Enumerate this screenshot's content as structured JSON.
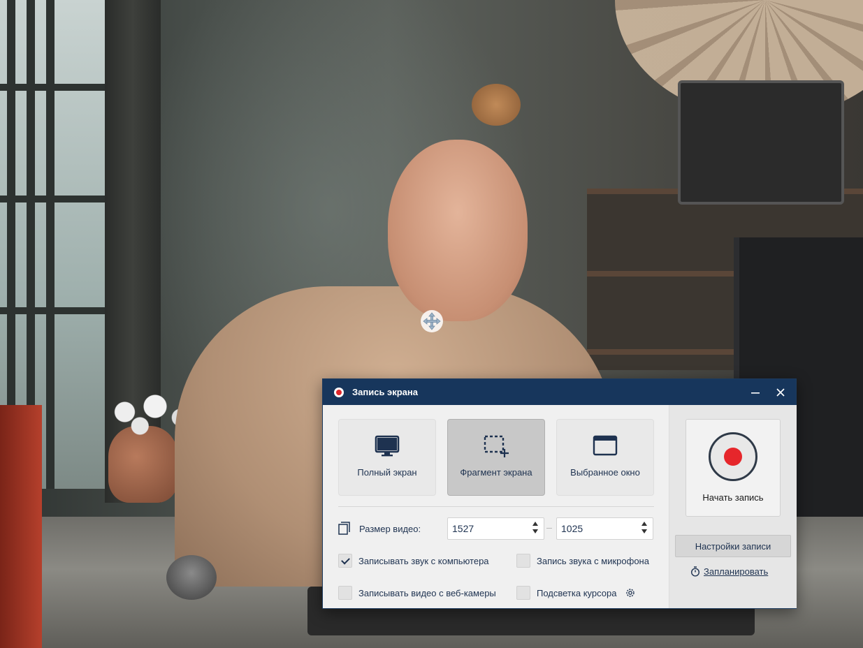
{
  "dialog": {
    "title": "Запись экрана",
    "minimize_glyph": "—",
    "close_glyph": "✕"
  },
  "modes": [
    {
      "label": "Полный экран",
      "icon": "monitor-icon",
      "active": false
    },
    {
      "label": "Фрагмент экрана",
      "icon": "dashed-selection-icon",
      "active": true
    },
    {
      "label": "Выбранное окно",
      "icon": "window-icon",
      "active": false
    }
  ],
  "video_size": {
    "label": "Размер видео:",
    "width": "1527",
    "height": "1025"
  },
  "options": [
    {
      "label": "Записывать звук с компьютера",
      "checked": true
    },
    {
      "label": "Запись звука с микрофона",
      "checked": false
    },
    {
      "label": "Записывать видео с веб-камеры",
      "checked": false
    },
    {
      "label": "Подсветка курсора",
      "checked": false
    }
  ],
  "record": {
    "label": "Начать запись",
    "settings_label": "Настройки записи",
    "schedule_label": "Запланировать"
  },
  "colors": {
    "titlebar": "#17365c",
    "record_dot": "#e6262b",
    "text": "#1e3250"
  }
}
